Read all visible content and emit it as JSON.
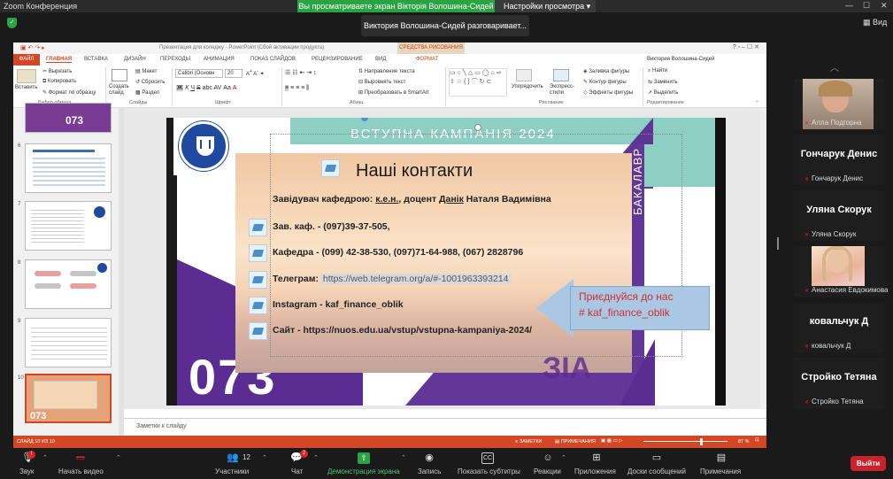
{
  "zoom": {
    "title": "Zoom Конференция",
    "viewing_banner": "Вы просматриваете экран Вікторія Волошина-Сидей",
    "view_options": "Настройки просмотра",
    "speaker": "Виктория Волошина-Сидей разговаривает...",
    "view_button": "Вид"
  },
  "ppt": {
    "window_title": "Презентация для коледжу - PowerPoint (Сбой активации продукта)",
    "context_tab_group": "СРЕДСТВА РИСОВАНИЯ",
    "tabs": [
      "ФАЙЛ",
      "ГЛАВНАЯ",
      "ВСТАВКА",
      "ДИЗАЙН",
      "ПЕРЕХОДЫ",
      "АНИМАЦИЯ",
      "ПОКАЗ СЛАЙДОВ",
      "РЕЦЕНЗИРОВАНИЕ",
      "ВИД",
      "ФОРМАТ"
    ],
    "user": "Виктория Волошина-Сидей",
    "ribbon": {
      "clipboard": {
        "paste": "Вставить",
        "cut": "Вырезать",
        "copy": "Копировать",
        "format": "Формат по образцу",
        "label": "Буфер обмена"
      },
      "slides": {
        "create": "Создать слайд",
        "layout": "Макет",
        "reset": "Сбросить",
        "section": "Раздел",
        "label": "Слайды"
      },
      "font": {
        "name": "Calibri (Основн",
        "size": "20",
        "label": "Шрифт"
      },
      "paragraph": {
        "direction": "Направление текста",
        "align": "Выровнять текст",
        "smartart": "Преобразовать в SmartArt",
        "label": "Абзац"
      },
      "drawing": {
        "arrange": "Упорядочить",
        "styles": "Экспресс-стили",
        "fill": "Заливка фигуры",
        "outline": "Контур фигуры",
        "effects": "Эффекты фигуры",
        "label": "Рисование"
      },
      "editing": {
        "find": "Найти",
        "replace": "Заменить",
        "select": "Выделить",
        "label": "Редактирование"
      }
    },
    "thumbs": [
      "6",
      "7",
      "8",
      "9",
      "10"
    ],
    "thumb_text": {
      "t1": "073",
      "t10": "073"
    },
    "notes_placeholder": "Заметки к слайду",
    "status": {
      "slide": "СЛАЙД 10 ИЗ 10",
      "notes": "ЗАМЕТКИ",
      "comments": "ПРИМЕЧАНИЯ",
      "zoom": "87 %"
    }
  },
  "slide": {
    "banner": "ВСТУПНА КАМПАНІЯ 2024",
    "side_label": "БАКАЛАВР",
    "big_number": "073",
    "heading": "Наші контакти",
    "head_prefix": "Завідувач кафедрою: ",
    "head_kn": "к.е.н.",
    "head_mid": ", доцент ",
    "head_danik": "Данік",
    "head_name": " Наталя Вадимівна",
    "line1": "Зав. каф. - (097)39-37-505,",
    "line2": "Кафедра -  (099) 42-38-530, (097)71-64-988, (067) 2828796",
    "telegram_label": "Телеграм: ",
    "telegram_link": "https://web.telegram.org/a/#-1001963393214",
    "line4": "Instagram - kaf_finance_oblik",
    "line5": "Сайт - https://nuos.edu.ua/vstup/vstupna-kampaniya-2024/",
    "callout1": "Приєднуйся до нас",
    "callout2": "# kaf_finance_oblik",
    "colors": {
      "purple": "#5b2c91",
      "teal": "#8ecfc4",
      "callout_text": "#d12f2f"
    }
  },
  "participants": [
    {
      "name": "Алла Подгорна",
      "video": true
    },
    {
      "name": "Гончарук Денис",
      "video": false
    },
    {
      "name": "Уляна Скорук",
      "video": false
    },
    {
      "name": "Анастасия Евдокимова",
      "video": true
    },
    {
      "name": "ковальчук Д",
      "video": false
    },
    {
      "name": "Стройко Тетяна",
      "video": false
    }
  ],
  "toolbar": {
    "audio": "Звук",
    "video": "Начать видео",
    "participants": "Участники",
    "participants_count": "12",
    "chat": "Чат",
    "chat_badge": "2",
    "share": "Демонстрация экрана",
    "record": "Запись",
    "captions": "Показать субтитры",
    "reactions": "Реакции",
    "apps": "Приложения",
    "whiteboards": "Доски сообщений",
    "notes": "Примечания",
    "leave": "Выйти"
  }
}
